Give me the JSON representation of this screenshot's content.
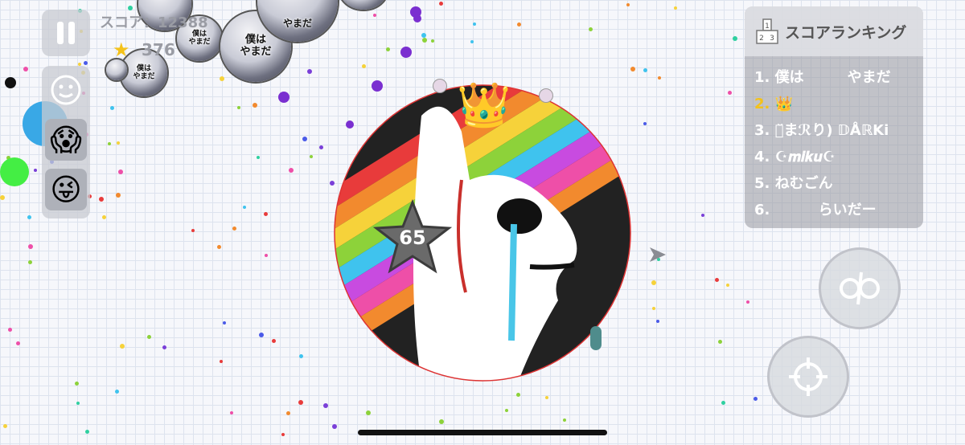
{
  "hud": {
    "score_label": "スコア：12388",
    "mass_value": "376"
  },
  "player": {
    "level": "65"
  },
  "ranking": {
    "title": "スコアランキング",
    "entries": [
      {
        "rank": "1.",
        "name": "僕は　　　やまだ"
      },
      {
        "rank": "2.",
        "name": "👑"
      },
      {
        "rank": "3.",
        "name": "つ̆まℛり) 𝔻ÅℝKi"
      },
      {
        "rank": "4.",
        "name": "☪𝒎𝒊𝒌𝒖☪"
      },
      {
        "rank": "5.",
        "name": "ねむごん"
      },
      {
        "rank": "6.",
        "name": "　　　らいだー"
      }
    ]
  },
  "cells": {
    "big_name_line1": "僕は",
    "big_name_line2": "やまだ",
    "small_name_line1": "僕は",
    "small_name_line2": "やまだ",
    "top_name": "やまだ"
  },
  "emotes": {
    "emote1": "😱",
    "emote2": "😜",
    "emote3": "😶"
  },
  "colors": {
    "accent_gold": "#f4c21a",
    "panel_bg": "#9a9ca4"
  }
}
